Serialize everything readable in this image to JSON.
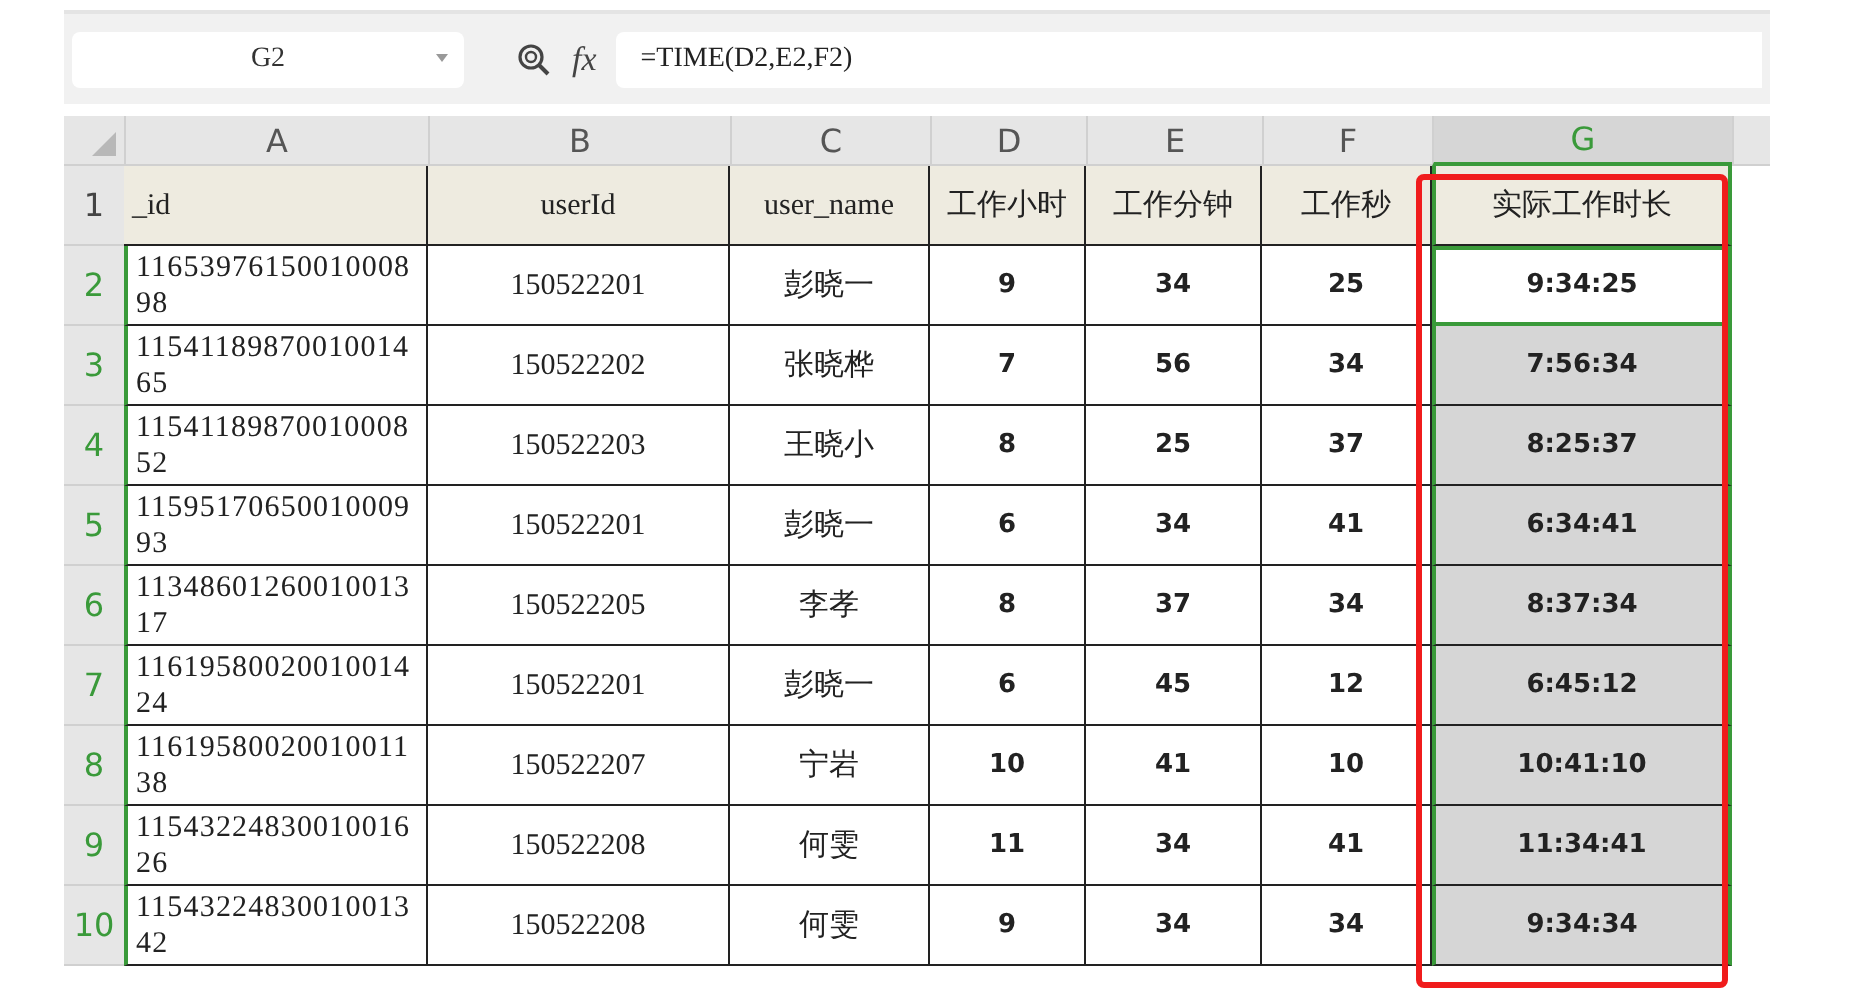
{
  "formula_bar": {
    "name_box": "G2",
    "fx": "fx",
    "formula": "=TIME(D2,E2,F2)"
  },
  "column_letters": [
    {
      "label": "A",
      "selected": false
    },
    {
      "label": "B",
      "selected": false
    },
    {
      "label": "C",
      "selected": false
    },
    {
      "label": "D",
      "selected": false
    },
    {
      "label": "E",
      "selected": false
    },
    {
      "label": "F",
      "selected": false
    },
    {
      "label": "G",
      "selected": true
    }
  ],
  "header_row": {
    "number": "1",
    "selected": false,
    "cells": [
      "_id",
      "userId",
      "user_name",
      "工作小时",
      "工作分钟",
      "工作秒",
      "实际工作时长"
    ]
  },
  "rows": [
    {
      "number": "2",
      "selected": true,
      "active": true,
      "cells": [
        "1165397615001000898",
        "150522201",
        "彭晓一",
        "9",
        "34",
        "25",
        "9:34:25"
      ]
    },
    {
      "number": "3",
      "selected": true,
      "active": false,
      "cells": [
        "1154118987001001465",
        "150522202",
        "张晓桦",
        "7",
        "56",
        "34",
        "7:56:34"
      ]
    },
    {
      "number": "4",
      "selected": true,
      "active": false,
      "cells": [
        "1154118987001000852",
        "150522203",
        "王晓小",
        "8",
        "25",
        "37",
        "8:25:37"
      ]
    },
    {
      "number": "5",
      "selected": true,
      "active": false,
      "cells": [
        "1159517065001000993",
        "150522201",
        "彭晓一",
        "6",
        "34",
        "41",
        "6:34:41"
      ]
    },
    {
      "number": "6",
      "selected": true,
      "active": false,
      "cells": [
        "1134860126001001317",
        "150522205",
        "李孝",
        "8",
        "37",
        "34",
        "8:37:34"
      ]
    },
    {
      "number": "7",
      "selected": true,
      "active": false,
      "cells": [
        "1161958002001001424",
        "150522201",
        "彭晓一",
        "6",
        "45",
        "12",
        "6:45:12"
      ]
    },
    {
      "number": "8",
      "selected": true,
      "active": false,
      "cells": [
        "1161958002001001138",
        "150522207",
        "宁岩",
        "10",
        "41",
        "10",
        "10:41:10"
      ]
    },
    {
      "number": "9",
      "selected": true,
      "active": false,
      "cells": [
        "1154322483001001626",
        "150522208",
        "何雯",
        "11",
        "34",
        "41",
        "11:34:41"
      ]
    },
    {
      "number": "10",
      "selected": true,
      "active": false,
      "cells": [
        "1154322483001001342",
        "150522208",
        "何雯",
        "9",
        "34",
        "34",
        "9:34:34"
      ]
    }
  ]
}
